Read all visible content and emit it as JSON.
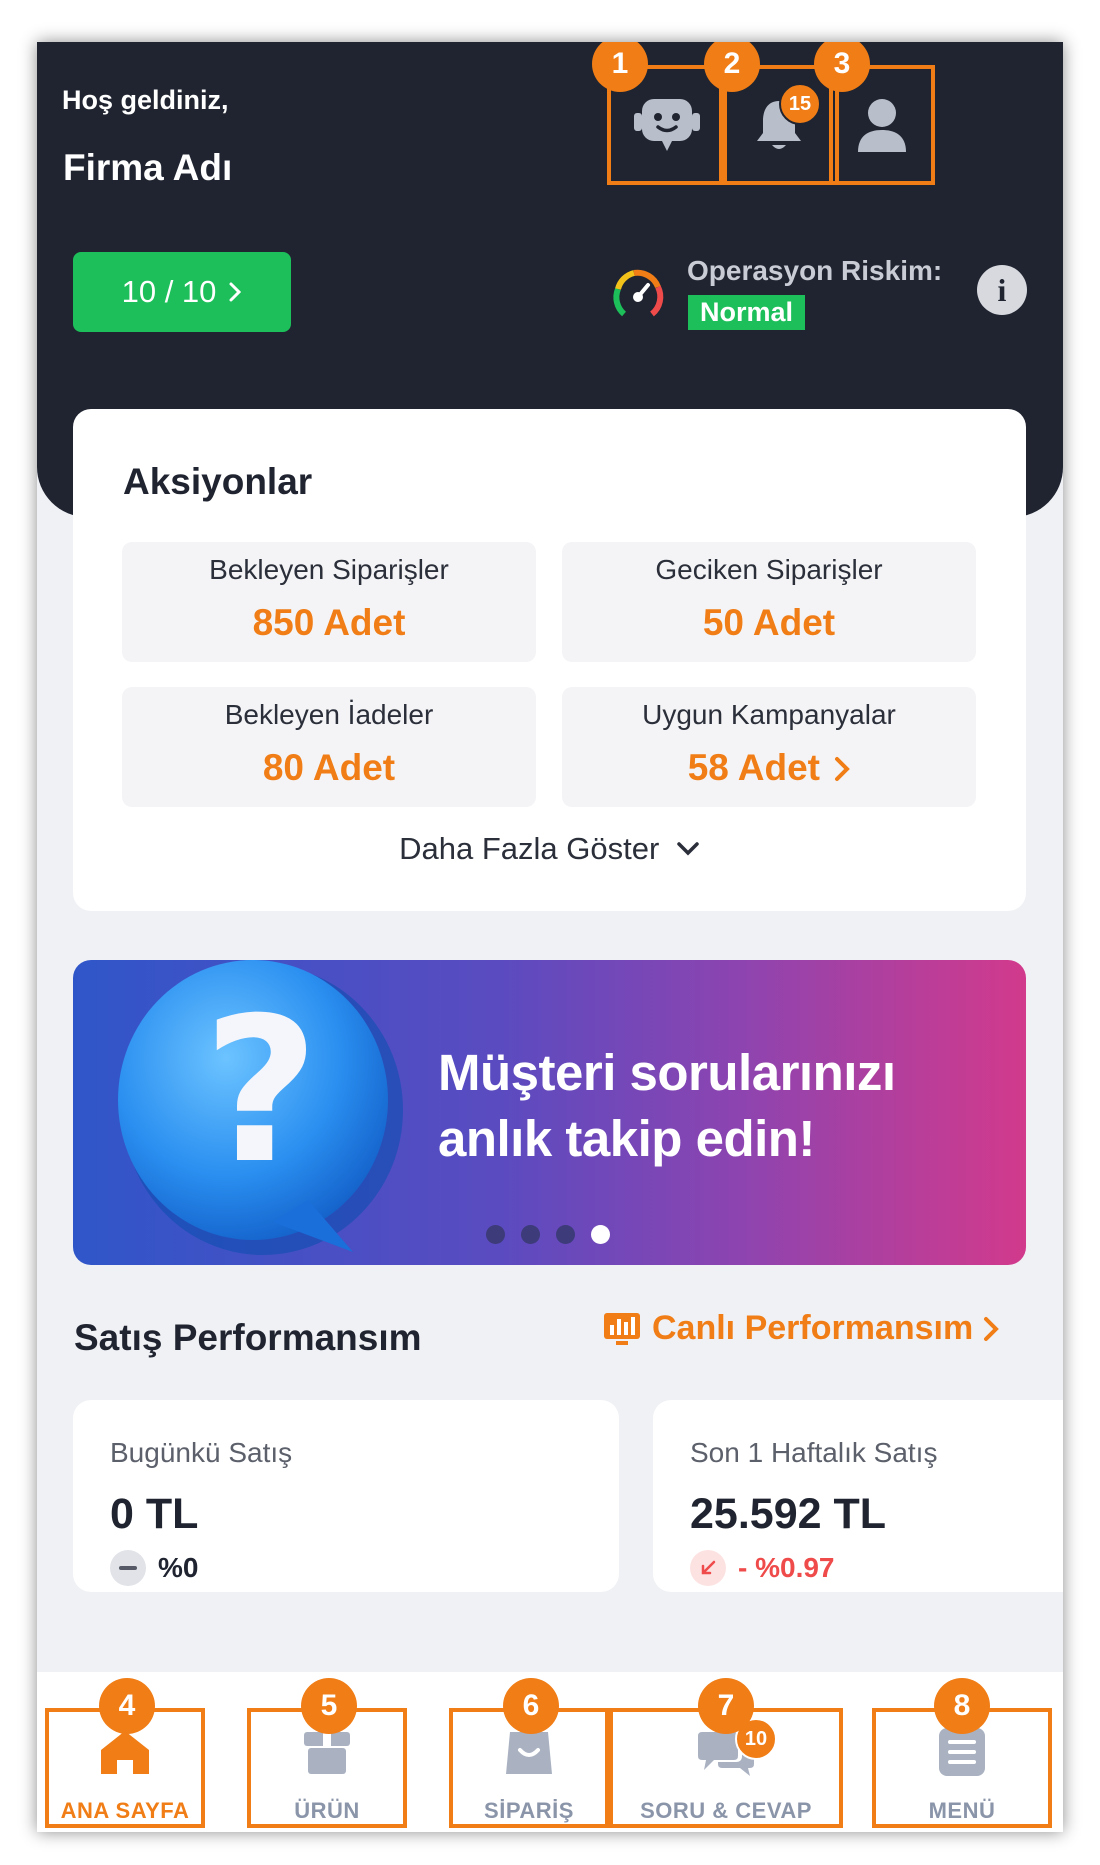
{
  "header": {
    "greeting": "Hoş geldiniz,",
    "company": "Firma Adı",
    "notification_count": "15",
    "score": "10 / 10",
    "risk_label": "Operasyon Riskim:",
    "risk_value": "Normal",
    "info_glyph": "i",
    "icons": [
      "chatbot-icon",
      "bell-icon",
      "profile-icon"
    ],
    "callouts": [
      "1",
      "2",
      "3"
    ]
  },
  "actions": {
    "title": "Aksiyonlar",
    "cards": [
      {
        "label": "Bekleyen Siparişler",
        "value": "850 Adet"
      },
      {
        "label": "Geciken Siparişler",
        "value": "50 Adet"
      },
      {
        "label": "Bekleyen İadeler",
        "value": "80 Adet"
      },
      {
        "label": "Uygun Kampanyalar",
        "value": "58 Adet"
      }
    ],
    "show_more": "Daha Fazla Göster"
  },
  "banner": {
    "line1": "Müşteri sorularınızı",
    "line2": "anlık takip edin!",
    "slides": 4,
    "active_slide": 4
  },
  "sales": {
    "title": "Satış Performansım",
    "live_link": "Canlı Performansım",
    "cards": [
      {
        "label": "Bugünkü Satış",
        "value": "0 TL",
        "change": "%0"
      },
      {
        "label": "Son 1 Haftalık Satış",
        "value": "25.592 TL",
        "change": "- %0.97"
      }
    ]
  },
  "tabbar": {
    "tabs": [
      {
        "label": "ANA SAYFA",
        "callout": "4",
        "icon": "home-icon",
        "active": true
      },
      {
        "label": "ÜRÜN",
        "callout": "5",
        "icon": "box-icon"
      },
      {
        "label": "SİPARİŞ",
        "callout": "6",
        "icon": "bag-icon"
      },
      {
        "label": "SORU & CEVAP",
        "callout": "7",
        "icon": "chat-icon",
        "badge": "10"
      },
      {
        "label": "MENÜ",
        "callout": "8",
        "icon": "menu-icon"
      }
    ]
  },
  "colors": {
    "accent": "#f07d16",
    "header_bg": "#1f2430",
    "success": "#1dbf5a",
    "negative": "#ef4b4b"
  }
}
